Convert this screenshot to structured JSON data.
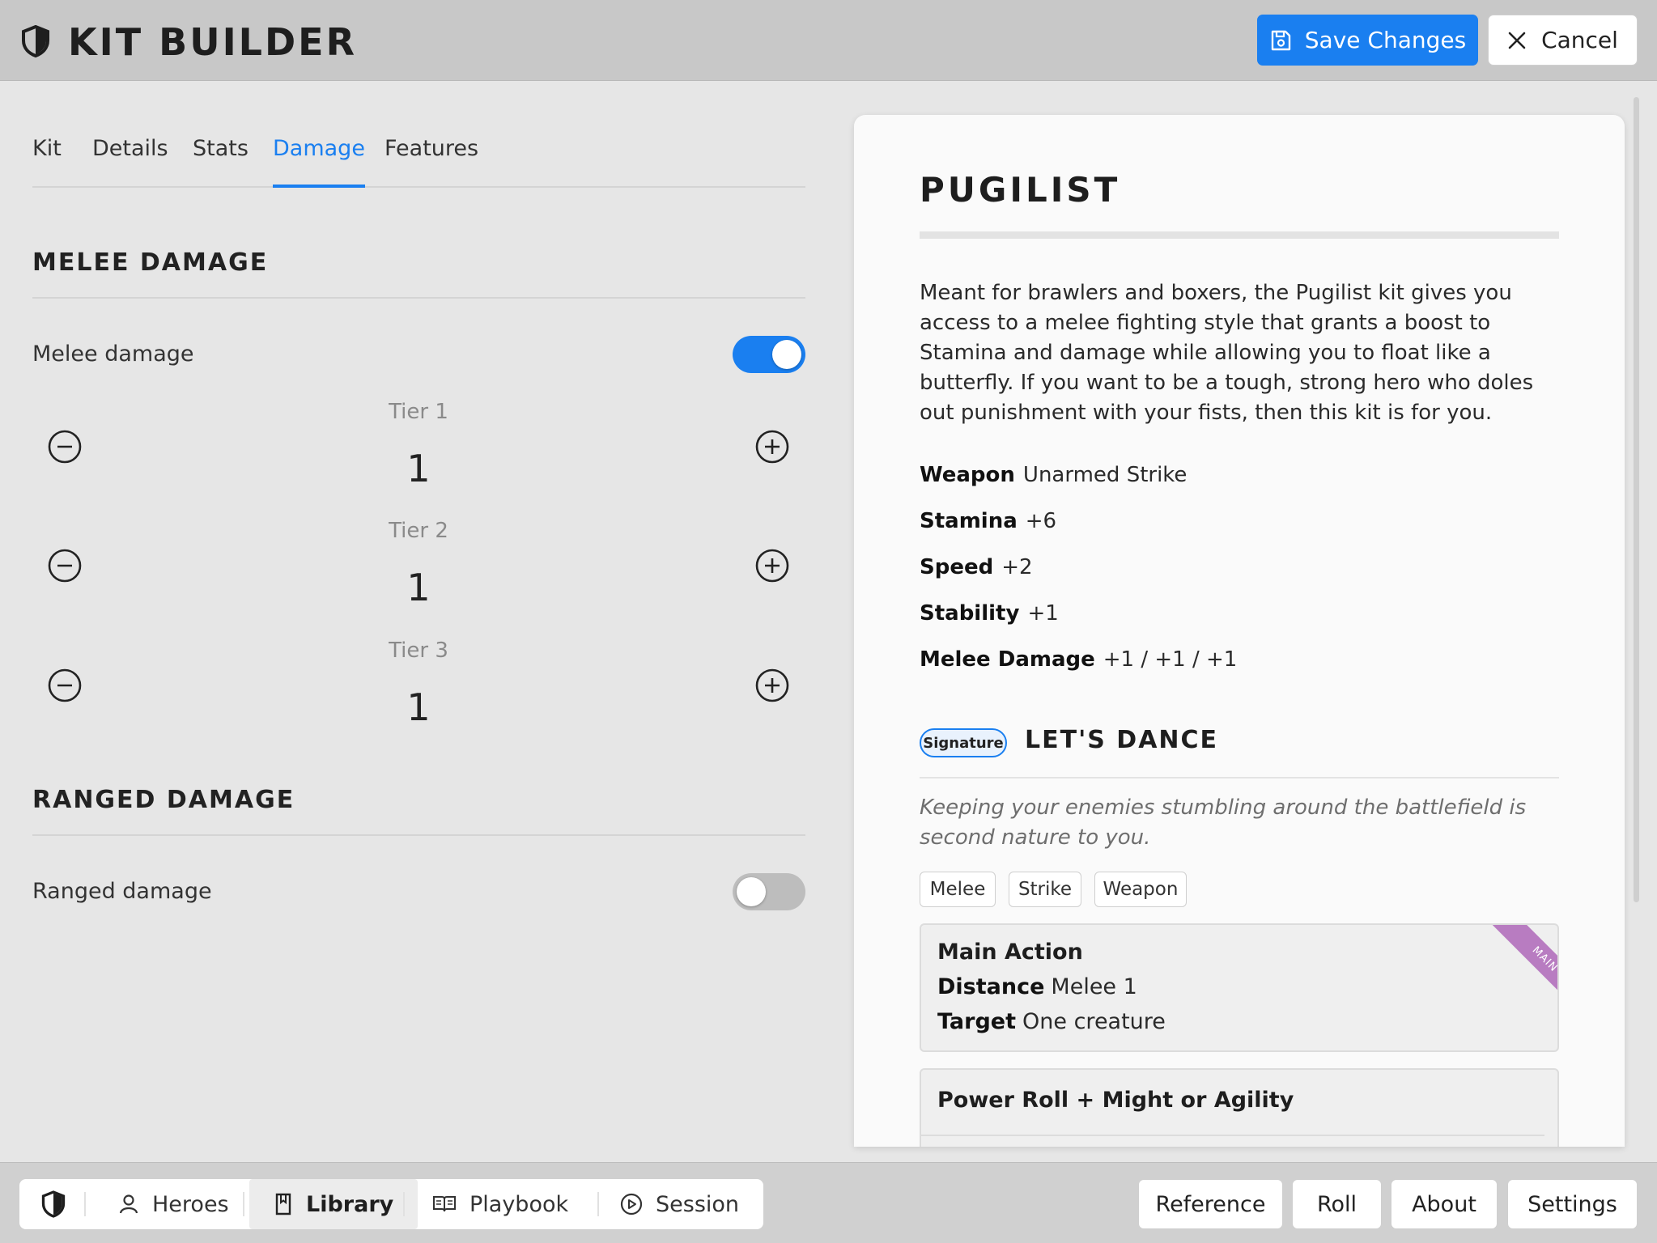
{
  "header": {
    "title": "KIT BUILDER",
    "save_label": "Save Changes",
    "cancel_label": "Cancel"
  },
  "tabs": [
    {
      "label": "Kit"
    },
    {
      "label": "Details"
    },
    {
      "label": "Stats"
    },
    {
      "label": "Damage",
      "active": true
    },
    {
      "label": "Features"
    }
  ],
  "melee": {
    "section_title": "MELEE DAMAGE",
    "toggle_label": "Melee damage",
    "enabled": true,
    "tiers": [
      {
        "label": "Tier 1",
        "value": "1"
      },
      {
        "label": "Tier 2",
        "value": "1"
      },
      {
        "label": "Tier 3",
        "value": "1"
      }
    ]
  },
  "ranged": {
    "section_title": "RANGED DAMAGE",
    "toggle_label": "Ranged damage",
    "enabled": false
  },
  "preview": {
    "name": "PUGILIST",
    "description": "Meant for brawlers and boxers, the Pugilist kit gives you access to a melee fighting style that grants a boost to Stamina and damage while allowing you to float like a butterfly. If you want to be a tough, strong hero who doles out punishment with your fists, then this kit is for you.",
    "stats": [
      {
        "label": "Weapon",
        "value": "Unarmed Strike"
      },
      {
        "label": "Stamina",
        "value": "+6"
      },
      {
        "label": "Speed",
        "value": "+2"
      },
      {
        "label": "Stability",
        "value": "+1"
      },
      {
        "label": "Melee Damage",
        "value": "+1 / +1 / +1"
      }
    ],
    "ability": {
      "badge": "Signature",
      "name": "LET'S DANCE",
      "flavor": "Keeping your enemies stumbling around the battlefield is second nature to you.",
      "keywords": [
        "Melee",
        "Strike",
        "Weapon"
      ],
      "action_type": "Main Action",
      "distance_label": "Distance",
      "distance_value": "Melee 1",
      "target_label": "Target",
      "target_value": "One creature",
      "ribbon": "MAIN",
      "power_roll": "Power Roll + Might or Agility"
    }
  },
  "bottom_nav": {
    "items": [
      {
        "label": "Heroes"
      },
      {
        "label": "Library",
        "active": true
      },
      {
        "label": "Playbook"
      },
      {
        "label": "Session"
      }
    ],
    "utility": [
      {
        "label": "Reference"
      },
      {
        "label": "Roll"
      },
      {
        "label": "About"
      },
      {
        "label": "Settings"
      }
    ]
  },
  "colors": {
    "accent": "#1a7ff0",
    "ribbon": "#b87cc1",
    "header_bg": "#c8c8c8",
    "page_bg": "#e6e6e6"
  },
  "icons": [
    "shield-icon",
    "save-icon",
    "close-icon",
    "minus-circle-icon",
    "plus-circle-icon",
    "user-icon",
    "book-icon",
    "open-book-icon",
    "play-circle-icon"
  ]
}
